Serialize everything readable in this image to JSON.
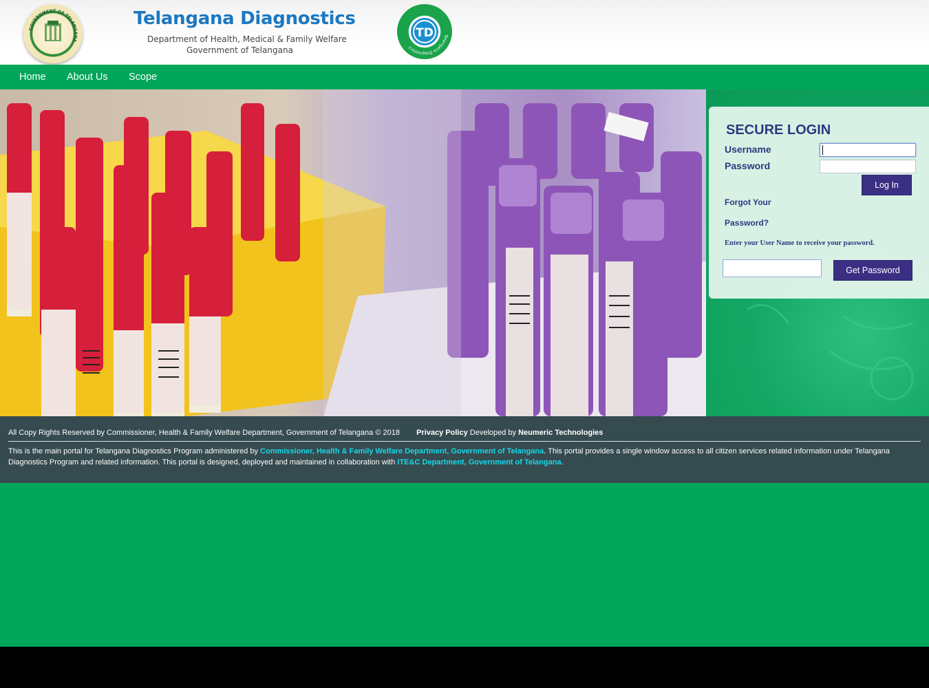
{
  "header": {
    "brand_title": "Telangana Diagnostics",
    "brand_subtitle_1": "Department of Health, Medical & Family Welfare",
    "brand_subtitle_2": "Government of Telangana",
    "emblem_ring_text": "GOVERNMENT OF TELANGANA",
    "td_logo_letters": "TD",
    "td_logo_ring_text": "Telangana Diagnostics"
  },
  "nav": {
    "items": [
      {
        "label": "Home"
      },
      {
        "label": "About Us"
      },
      {
        "label": "Scope"
      }
    ]
  },
  "login": {
    "title": "SECURE LOGIN",
    "username_label": "Username",
    "password_label": "Password",
    "username_value": "",
    "password_value": "",
    "login_button": "Log In",
    "forgot_line1": "Forgot Your",
    "forgot_line2": "Password?",
    "hint": "Enter your User Name to receive your password.",
    "recover_value": "",
    "get_password_button": "Get Password"
  },
  "footer": {
    "copyright": "All Copy Rights Reserved by Commissioner, Health & Family Welfare Department, Government of Telangana © 2018",
    "privacy_policy": "Privacy Policy",
    "developed_by": "Developed by",
    "developer": "Neumeric Technologies",
    "desc_part1": "This is the main portal for Telangana Diagnostics Program administered by ",
    "desc_link1": "Commissioner, Health & Family Welfare Department, Government of Telangana",
    "desc_part2": ". This portal provides a single window access to all citizen services related information under Telangana Diagnostics Program and related information. This portal is designed, deployed and maintained in collaboration with ",
    "desc_link2": "ITE&C Department, Government of Telangana",
    "desc_part3": "."
  },
  "colors": {
    "brand_green": "#00a65a",
    "login_blue": "#2b3a7e",
    "button_purple": "#3a2f82",
    "footer_bg": "#354b4f",
    "link_cyan": "#18d8e8"
  },
  "icons": {
    "emblem": "telangana-emblem-icon",
    "td_logo": "td-logo-icon"
  }
}
